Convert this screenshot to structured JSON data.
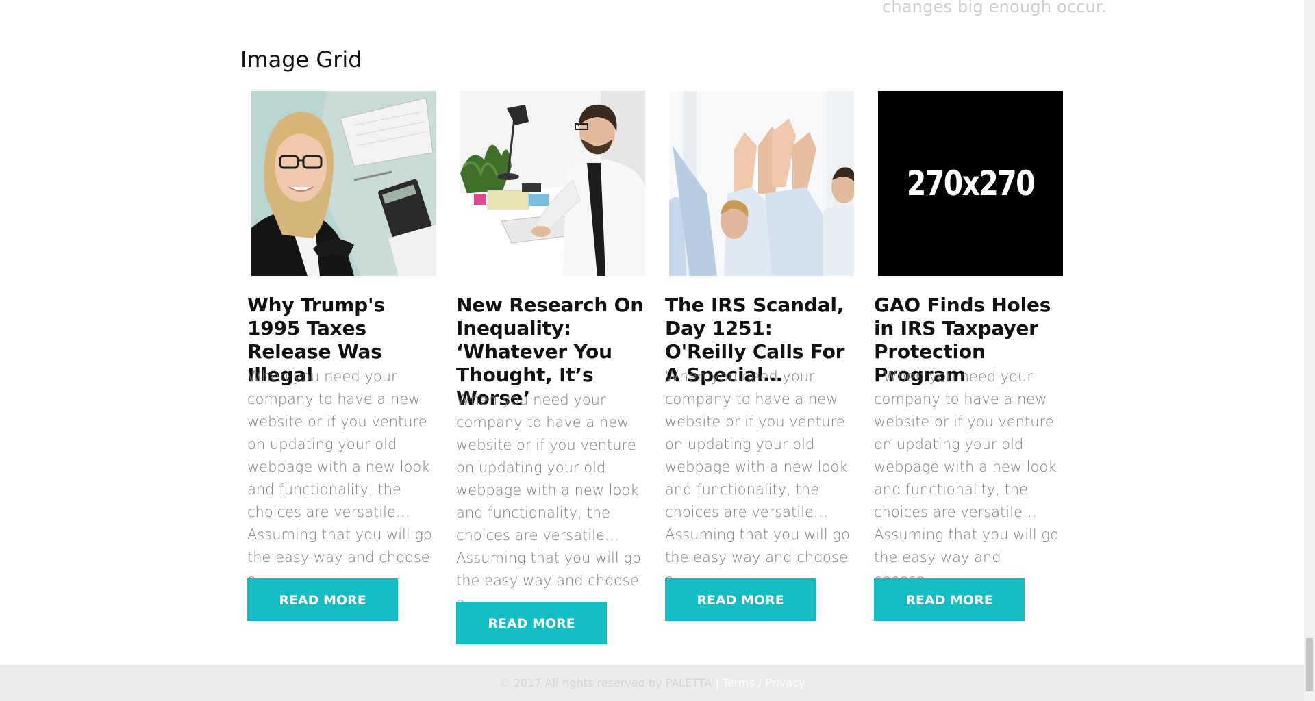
{
  "top_fragment_text": "changes big enough occur.",
  "section": {
    "title": "Image Grid"
  },
  "cards": [
    {
      "image_alt": "Smiling businesswoman at desk with calculator",
      "title": "Why Trump's 1995 Taxes Release Was Illegal",
      "excerpt": "When you need your company to have a new website or if you venture on updating your old webpage with a new look and functionality, the choices are versatile… Assuming that you will go the easy way and choose a…",
      "button": "READ MORE"
    },
    {
      "image_alt": "Man working at computer in office",
      "title": "New Research On Inequality: ‘Whatever You Thought, It’s Worse’",
      "excerpt": "When you need your company to have a new website or if you venture on updating your old webpage with a new look and functionality, the choices are versatile… Assuming that you will go the easy way and choose a…",
      "button": "READ MORE"
    },
    {
      "image_alt": "Team giving high five",
      "title": "The IRS Scandal, Day 1251: O'Reilly Calls For A Special…",
      "excerpt": "When you need your company to have a new website or if you venture on updating your old webpage with a new look and functionality, the choices are versatile… Assuming that you will go the easy way and choose a…",
      "button": "READ MORE"
    },
    {
      "image_alt": "Placeholder image",
      "placeholder_text": "270x270",
      "title": "GAO Finds Holes in IRS Taxpayer Protection Program",
      "excerpt": "  When you need your company to have a new website or if you venture on updating your old webpage with a new look and functionality, the choices are versatile… Assuming that you will go the easy way and choose…",
      "button": "READ MORE"
    }
  ],
  "footer": {
    "copyright": "© 2017 All rights reserved by PALETTA",
    "divider": " | ",
    "terms": "Terms",
    "slash": " / ",
    "privacy": "Privacy"
  },
  "colors": {
    "accent": "#12bec3",
    "heading": "#111111",
    "body_text": "#808080",
    "footer_bg": "#ececec"
  }
}
